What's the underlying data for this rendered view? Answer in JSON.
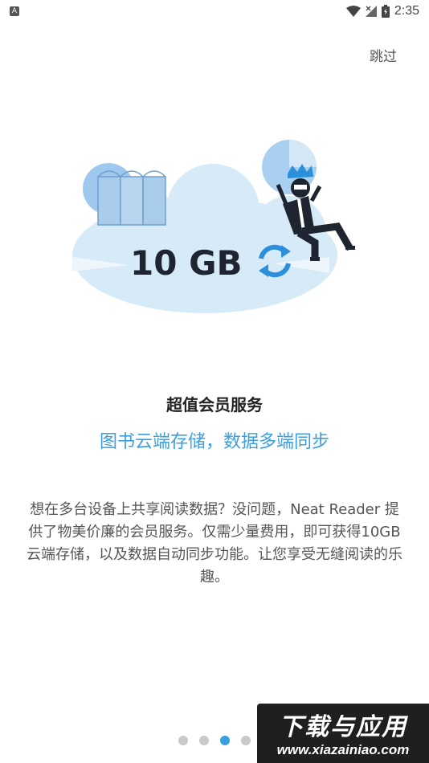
{
  "status_bar": {
    "time": "2:35",
    "app_badge": "A"
  },
  "skip_label": "跳过",
  "illustration": {
    "storage_text": "10 GB"
  },
  "headline": "超值会员服务",
  "subheadline": "图书云端存储，数据多端同步",
  "description": "想在多台设备上共享阅读数据？没问题，Neat Reader 提供了物美价廉的会员服务。仅需少量费用，即可获得10GB云端存储，以及数据自动同步功能。让您享受无缝阅读的乐趣。",
  "pager": {
    "total": 4,
    "active_index": 2
  },
  "watermark": {
    "title": "下载与应用",
    "url": "www.xiazainiao.com"
  },
  "colors": {
    "accent": "#3a9fe0",
    "cloud": "#d6eaf8",
    "book": "#a8ccea"
  }
}
